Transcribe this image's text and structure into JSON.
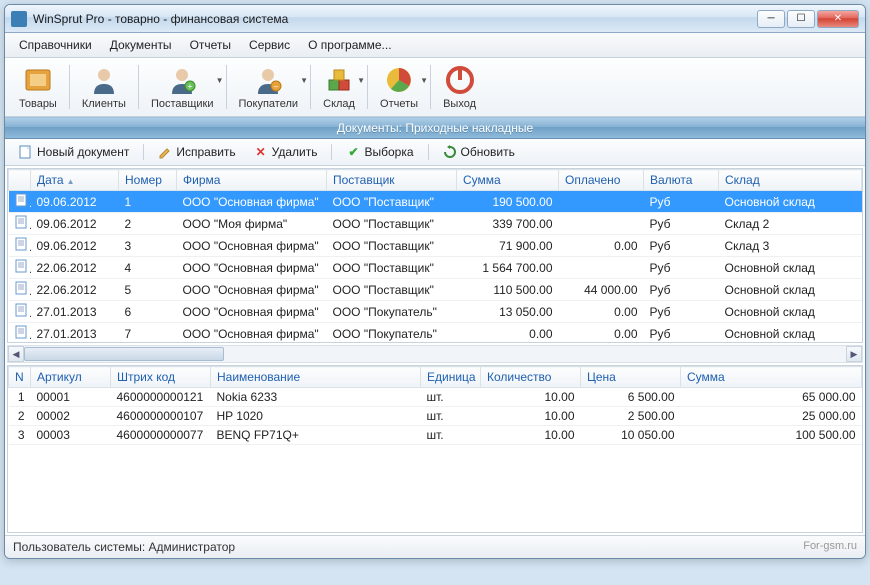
{
  "window": {
    "title": "WinSprut Pro - товарно - финансовая система"
  },
  "menu": {
    "items": [
      "Справочники",
      "Документы",
      "Отчеты",
      "Сервис",
      "О программе..."
    ]
  },
  "toolbar": {
    "items": [
      {
        "label": "Товары",
        "name": "goods",
        "dd": false,
        "color": "#e6a23c"
      },
      {
        "label": "Клиенты",
        "name": "clients",
        "dd": false,
        "color": "#b97b55"
      },
      {
        "label": "Поставщики",
        "name": "suppliers",
        "dd": true,
        "color": "#b97b55"
      },
      {
        "label": "Покупатели",
        "name": "buyers",
        "dd": true,
        "color": "#b97b55"
      },
      {
        "label": "Склад",
        "name": "warehouse",
        "dd": true,
        "color": "#5aa84c"
      },
      {
        "label": "Отчеты",
        "name": "reports",
        "dd": true,
        "color": "#d9b93b"
      },
      {
        "label": "Выход",
        "name": "exit",
        "dd": false,
        "color": "#d14b3b"
      }
    ]
  },
  "section": {
    "title": "Документы: Приходные накладные"
  },
  "actions": {
    "new": "Новый документ",
    "edit": "Исправить",
    "delete": "Удалить",
    "filter": "Выборка",
    "refresh": "Обновить"
  },
  "grid": {
    "columns": [
      "Дата",
      "Номер",
      "Фирма",
      "Поставщик",
      "Сумма",
      "Оплачено",
      "Валюта",
      "Склад"
    ],
    "rows": [
      {
        "date": "09.06.2012",
        "num": "1",
        "firm": "ООО \"Основная фирма\"",
        "supplier": "ООО \"Поставщик\"",
        "sum": "190 500.00",
        "paid": "",
        "cur": "Руб",
        "wh": "Основной склад",
        "sel": true
      },
      {
        "date": "09.06.2012",
        "num": "2",
        "firm": "ООО \"Моя фирма\"",
        "supplier": "ООО \"Поставщик\"",
        "sum": "339 700.00",
        "paid": "",
        "cur": "Руб",
        "wh": "Склад 2"
      },
      {
        "date": "09.06.2012",
        "num": "3",
        "firm": "ООО \"Основная фирма\"",
        "supplier": "ООО \"Поставщик\"",
        "sum": "71 900.00",
        "paid": "0.00",
        "cur": "Руб",
        "wh": "Склад 3"
      },
      {
        "date": "22.06.2012",
        "num": "4",
        "firm": "ООО \"Основная фирма\"",
        "supplier": "ООО \"Поставщик\"",
        "sum": "1 564 700.00",
        "paid": "",
        "cur": "Руб",
        "wh": "Основной склад"
      },
      {
        "date": "22.06.2012",
        "num": "5",
        "firm": "ООО \"Основная фирма\"",
        "supplier": "ООО \"Поставщик\"",
        "sum": "110 500.00",
        "paid": "44 000.00",
        "cur": "Руб",
        "wh": "Основной склад"
      },
      {
        "date": "27.01.2013",
        "num": "6",
        "firm": "ООО \"Основная фирма\"",
        "supplier": "ООО \"Покупатель\"",
        "sum": "13 050.00",
        "paid": "0.00",
        "cur": "Руб",
        "wh": "Основной склад"
      },
      {
        "date": "27.01.2013",
        "num": "7",
        "firm": "ООО \"Основная фирма\"",
        "supplier": "ООО \"Покупатель\"",
        "sum": "0.00",
        "paid": "0.00",
        "cur": "Руб",
        "wh": "Основной склад"
      }
    ]
  },
  "detail": {
    "columns": [
      "N",
      "Артикул",
      "Штрих код",
      "Наименование",
      "Единица",
      "Количество",
      "Цена",
      "Сумма"
    ],
    "rows": [
      {
        "n": "1",
        "art": "00001",
        "bar": "4600000000121",
        "name": "Nokia 6233",
        "unit": "шт.",
        "qty": "10.00",
        "price": "6 500.00",
        "sum": "65 000.00"
      },
      {
        "n": "2",
        "art": "00002",
        "bar": "4600000000107",
        "name": "HP 1020",
        "unit": "шт.",
        "qty": "10.00",
        "price": "2 500.00",
        "sum": "25 000.00"
      },
      {
        "n": "3",
        "art": "00003",
        "bar": "4600000000077",
        "name": "BENQ FP71Q+",
        "unit": "шт.",
        "qty": "10.00",
        "price": "10 050.00",
        "sum": "100 500.00"
      }
    ]
  },
  "status": {
    "text": "Пользователь системы: Администратор",
    "watermark": "For-gsm.ru"
  }
}
